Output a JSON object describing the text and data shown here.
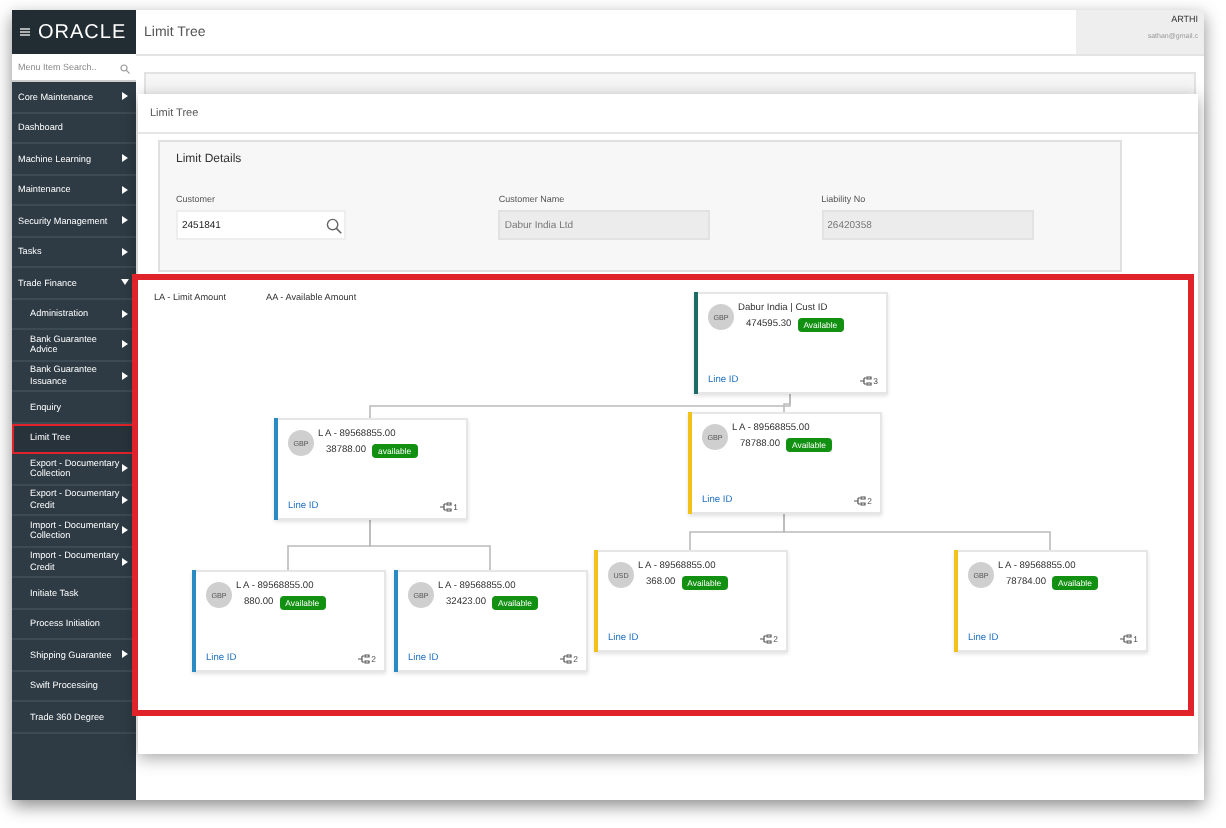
{
  "sidebar": {
    "logo": "ORACLE",
    "search": {
      "placeholder": "Menu Item Search.."
    },
    "items": [
      {
        "label": "Core Maintenance",
        "submenu": true,
        "selected": false
      },
      {
        "label": "Dashboard",
        "submenu": false,
        "selected": false
      },
      {
        "label": "Machine Learning",
        "submenu": true,
        "selected": false
      },
      {
        "label": "Maintenance",
        "submenu": true,
        "selected": false
      },
      {
        "label": "Security Management",
        "submenu": true,
        "selected": false
      },
      {
        "label": "Tasks",
        "submenu": true,
        "selected": false
      },
      {
        "label": "Trade Finance",
        "submenu": true,
        "selected": false,
        "expanded": true,
        "children": [
          {
            "label": "Administration",
            "submenu": true,
            "selected": false
          },
          {
            "label": "Bank Guarantee Advice",
            "submenu": true,
            "selected": false
          },
          {
            "label": "Bank Guarantee Issuance",
            "submenu": true,
            "selected": false
          },
          {
            "label": "Enquiry",
            "submenu": false,
            "selected": false
          },
          {
            "label": "Limit Tree",
            "submenu": false,
            "selected": true
          },
          {
            "label": "Export - Documentary Collection",
            "submenu": true,
            "selected": false
          },
          {
            "label": "Export - Documentary Credit",
            "submenu": true,
            "selected": false
          },
          {
            "label": "Import - Documentary Collection",
            "submenu": true,
            "selected": false
          },
          {
            "label": "Import - Documentary Credit",
            "submenu": true,
            "selected": false
          },
          {
            "label": "Initiate Task",
            "submenu": false,
            "selected": false
          },
          {
            "label": "Process Initiation",
            "submenu": false,
            "selected": false
          },
          {
            "label": "Shipping Guarantee",
            "submenu": true,
            "selected": false
          },
          {
            "label": "Swift Processing",
            "submenu": false,
            "selected": false
          },
          {
            "label": "Trade 360 Degree",
            "submenu": false,
            "selected": false
          }
        ]
      }
    ]
  },
  "header": {
    "title": "Limit Tree",
    "user": {
      "name": "ARTHI",
      "email": "sathan@gmail.c"
    }
  },
  "modal": {
    "title": "Limit Tree",
    "details": {
      "title": "Limit Details",
      "fields": [
        {
          "label": "Customer",
          "value": "2451841",
          "kind": "search"
        },
        {
          "label": "Customer Name",
          "value": "Dabur India Ltd",
          "kind": "readonly"
        },
        {
          "label": "Liability No",
          "value": "26420358",
          "kind": "readonly"
        }
      ]
    },
    "tree": {
      "legend": [
        "LA - Limit Amount",
        "AA - Available Amount"
      ],
      "root": {
        "currency": "GBP",
        "title": "Dabur India | Cust ID",
        "amount": "474595.30",
        "status": "Available",
        "link": "Line ID",
        "count": "3",
        "color": "#1d6b66",
        "children": [
          {
            "currency": "GBP",
            "title": "L A -  89568855.00",
            "amount": "38788.00",
            "status": "available",
            "link": "Line ID",
            "count": "1",
            "color": "#2a8ac4",
            "children": [
              {
                "currency": "GBP",
                "title": "L A - 89568855.00",
                "amount": "880.00",
                "status": "Available",
                "link": "Line ID",
                "count": "2",
                "color": "#2a8ac4"
              },
              {
                "currency": "GBP",
                "title": "L A - 89568855.00",
                "amount": "32423.00",
                "status": "Available",
                "link": "Line ID",
                "count": "2",
                "color": "#2a8ac4"
              }
            ]
          },
          {
            "currency": "GBP",
            "title": "L A - 89568855.00",
            "amount": "78788.00",
            "status": "Available",
            "link": "Line ID",
            "count": "2",
            "color": "#f2c21b",
            "children": [
              {
                "currency": "USD",
                "title": "L A - 89568855.00",
                "amount": "368.00",
                "status": "Available",
                "link": "Line ID",
                "count": "2",
                "color": "#f2c21b"
              },
              {
                "currency": "GBP",
                "title": "L A - 89568855.00",
                "amount": "78784.00",
                "status": "Available",
                "link": "Line ID",
                "count": "1",
                "color": "#f2c21b"
              }
            ]
          }
        ]
      }
    }
  }
}
